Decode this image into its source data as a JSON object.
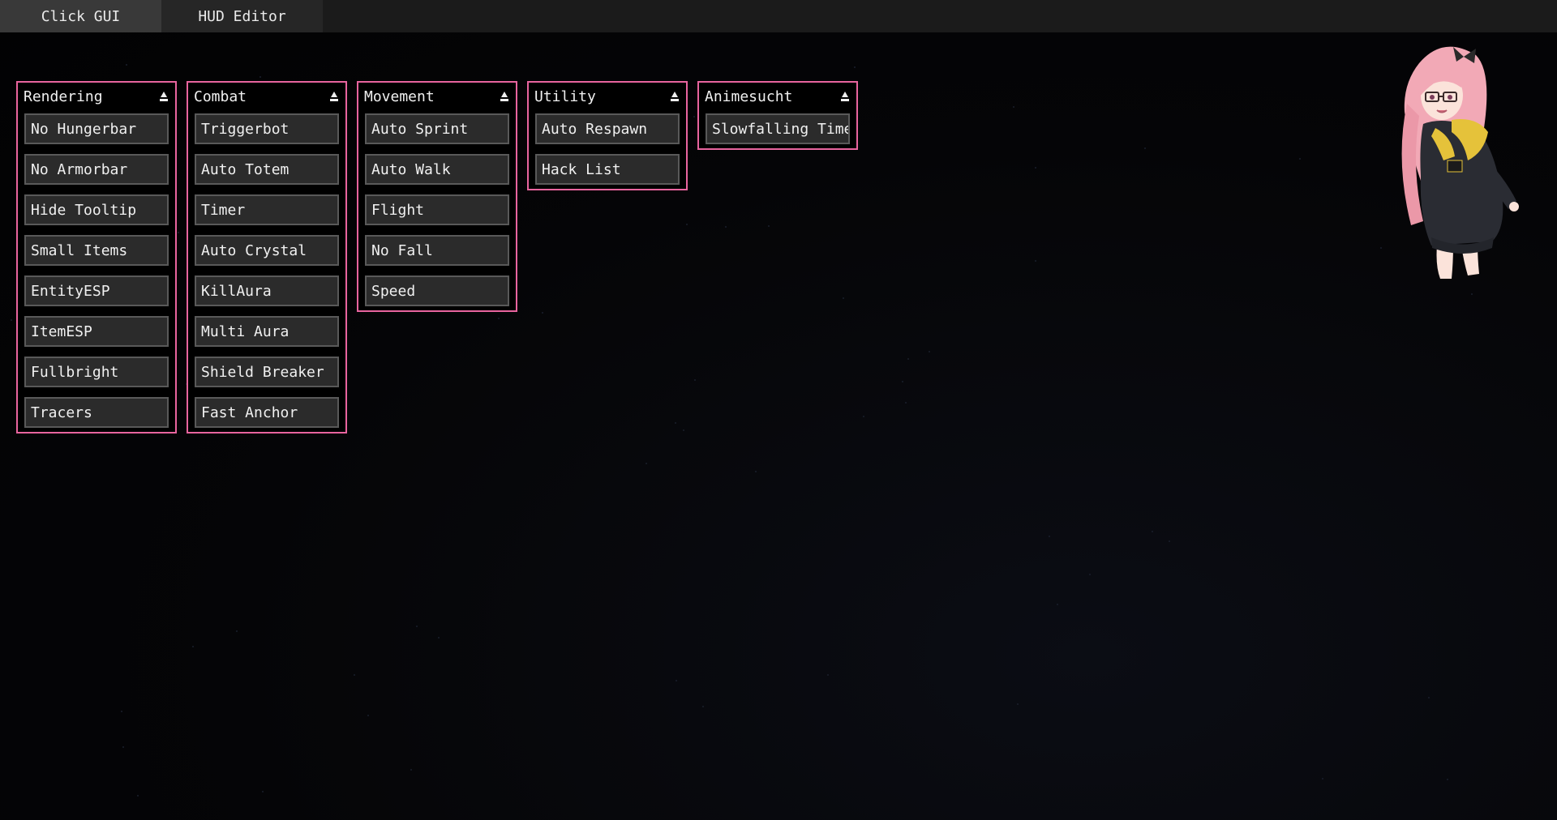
{
  "tabs": [
    {
      "label": "Click GUI",
      "active": true
    },
    {
      "label": "HUD Editor",
      "active": false
    }
  ],
  "theme": {
    "accent": "#e8649e",
    "background": "#050507",
    "item_bg": "#2b2b2b",
    "item_border": "#595959"
  },
  "panels": [
    {
      "title": "Rendering",
      "icon": "collapse-arrow-icon",
      "items": [
        "No Hungerbar",
        "No Armorbar",
        "Hide Tooltip",
        "Small Items",
        "EntityESP",
        "ItemESP",
        "Fullbright",
        "Tracers"
      ]
    },
    {
      "title": "Combat",
      "icon": "collapse-arrow-icon",
      "items": [
        "Triggerbot",
        "Auto Totem",
        "Timer",
        "Auto Crystal",
        "KillAura",
        "Multi Aura",
        "Shield Breaker",
        "Fast Anchor"
      ]
    },
    {
      "title": "Movement",
      "icon": "collapse-arrow-icon",
      "items": [
        "Auto Sprint",
        "Auto Walk",
        "Flight",
        "No Fall",
        "Speed"
      ]
    },
    {
      "title": "Utility",
      "icon": "collapse-arrow-icon",
      "items": [
        "Auto Respawn",
        "Hack List"
      ]
    },
    {
      "title": "Animesucht",
      "icon": "collapse-arrow-icon",
      "items": [
        "Slowfalling Timer"
      ]
    }
  ],
  "mascot": {
    "icon": "anime-character-image"
  }
}
